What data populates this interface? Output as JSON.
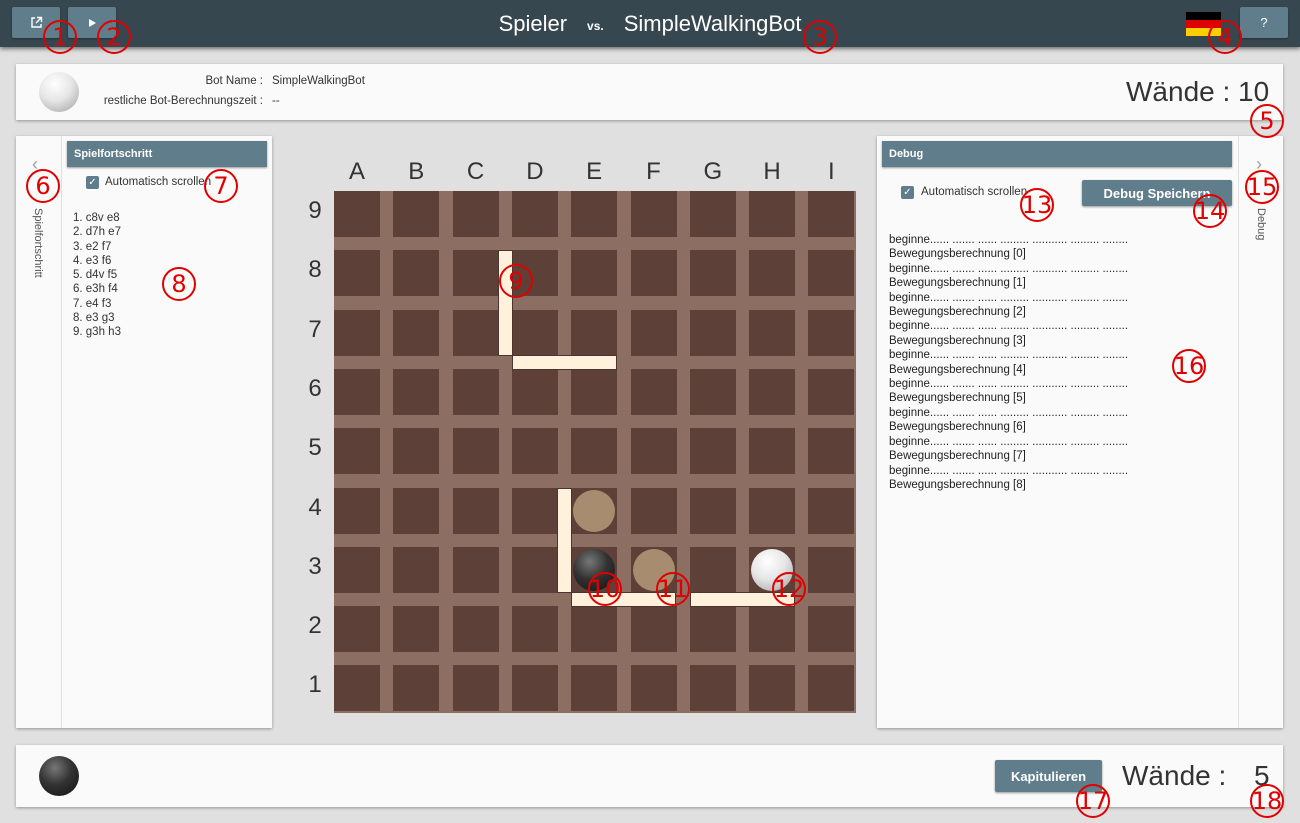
{
  "topbar": {
    "player_left": "Spieler",
    "vs": "vs.",
    "player_right": "SimpleWalkingBot",
    "open_icon": "external-link-icon",
    "play_icon": "play-icon",
    "help_label": "?",
    "flag_colors": [
      "#000000",
      "#dd0000",
      "#ffce00"
    ]
  },
  "top_player": {
    "bot_name_label": "Bot Name :",
    "bot_name_value": "SimpleWalkingBot",
    "time_label": "restliche Bot-Berechnungszeit :",
    "time_value": "--",
    "walls_label": "Wände :",
    "walls_value": "10"
  },
  "left_panel": {
    "collapse_icon": "chevron-left-icon",
    "vertical_label": "Spielfortschritt",
    "header": "Spielfortschritt",
    "autoscroll_label": "Automatisch scrollen",
    "moves": [
      "1. c8v e8",
      "2. d7h e7",
      "3. e2 f7",
      "4. e3 f6",
      "5. d4v f5",
      "6. e3h f4",
      "7. e4 f3",
      "8. e3 g3",
      "9. g3h h3"
    ]
  },
  "board": {
    "columns": [
      "A",
      "B",
      "C",
      "D",
      "E",
      "F",
      "G",
      "H",
      "I"
    ],
    "rows": [
      "9",
      "8",
      "7",
      "6",
      "5",
      "4",
      "3",
      "2",
      "1"
    ],
    "background": "#8d6e63",
    "cell_color": "#5d4037",
    "wall_color": "#fff1dc"
  },
  "right_panel": {
    "header": "Debug",
    "autoscroll_label": "Automatisch scrollen",
    "save_label": "Debug Speichern",
    "collapse_icon": "chevron-right-icon",
    "vertical_label": "Debug",
    "log": [
      "beginne...... ....... ...... ......... ........... ......... ........",
      "Bewegungsberechnung [0]",
      "beginne...... ....... ...... ......... ........... ......... ........",
      "Bewegungsberechnung [1]",
      "beginne...... ....... ...... ......... ........... ......... ........",
      "Bewegungsberechnung [2]",
      "beginne...... ....... ...... ......... ........... ......... ........",
      "Bewegungsberechnung [3]",
      "beginne...... ....... ...... ......... ........... ......... ........",
      "Bewegungsberechnung [4]",
      "beginne...... ....... ...... ......... ........... ......... ........",
      "Bewegungsberechnung [5]",
      "beginne...... ....... ...... ......... ........... ......... ........",
      "Bewegungsberechnung [6]",
      "beginne...... ....... ...... ......... ........... ......... ........",
      "Bewegungsberechnung [7]",
      "beginne...... ....... ...... ......... ........... ......... ........",
      "Bewegungsberechnung [8]"
    ]
  },
  "bottom_player": {
    "surrender_label": "Kapitulieren",
    "walls_label": "Wände :",
    "walls_value": "5"
  },
  "annotations": [
    "1",
    "2",
    "3",
    "4",
    "5",
    "6",
    "7",
    "8",
    "9",
    "10",
    "11",
    "12",
    "13",
    "14",
    "15",
    "16",
    "17",
    "18"
  ]
}
